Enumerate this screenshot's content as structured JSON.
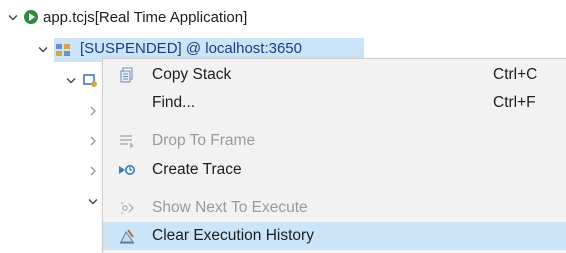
{
  "tree": {
    "app_label": "app.tcjs[Real Time Application]",
    "thread_label": "[SUSPENDED] @ localhost:3650"
  },
  "context_menu": {
    "items": [
      {
        "label": "Copy Stack",
        "accelerator": "Ctrl+C",
        "icon": "copy-stack-icon",
        "enabled": true
      },
      {
        "label": "Find...",
        "accelerator": "Ctrl+F",
        "icon": "",
        "enabled": true
      },
      {
        "label": "Drop To Frame",
        "accelerator": "",
        "icon": "drop-to-frame-icon",
        "enabled": false
      },
      {
        "label": "Create Trace",
        "accelerator": "",
        "icon": "create-trace-icon",
        "enabled": true
      },
      {
        "label": "Show Next To Execute",
        "accelerator": "",
        "icon": "show-next-icon",
        "enabled": false
      },
      {
        "label": "Clear Execution History",
        "accelerator": "",
        "icon": "clear-history-icon",
        "enabled": true,
        "highlighted": true
      }
    ]
  },
  "colors": {
    "selection": "#cce4f7",
    "menu_background": "#f2f2f2",
    "disabled_text": "#9a9a9a",
    "run_icon": "#2e8b3d"
  }
}
